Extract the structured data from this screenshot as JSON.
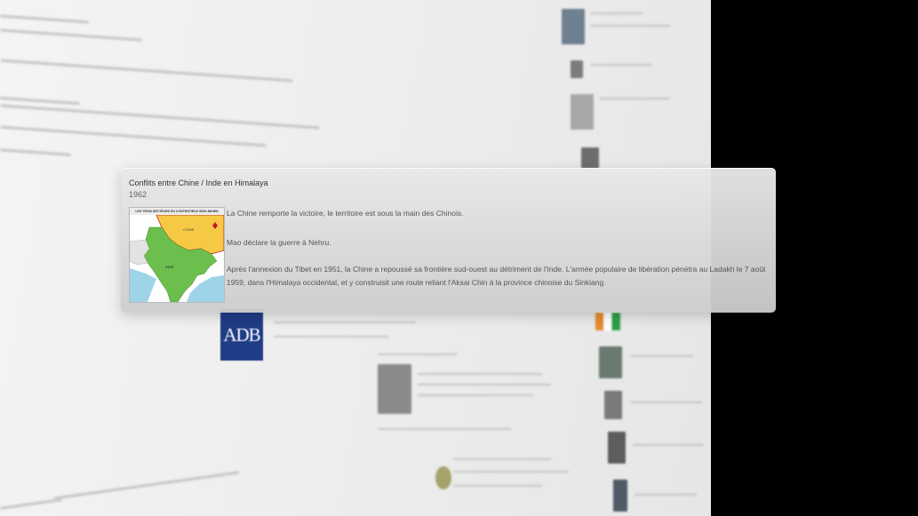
{
  "card": {
    "title": "Conflits entre Chine / Inde en Himalaya",
    "year": "1962",
    "map_caption": "LES TROIS SECTEURS DU CONTENTIEUX SINO-INDIEN",
    "paragraphs": [
      "La Chine remporte la victoire, le territoire est sous la main des Chinois.",
      "Mao déclare la guerre à Nehru.",
      "Après l'annexion du Tibet en 1951, la Chine a repoussé sa frontière sud-ouest au détriment de l'Inde. L'armée populaire de libération pénétra au Ladakh le 7 août 1959, dans l'Himalaya occidental, et y construisit une route reliant l'Aksai Chin à la province chinoise du Sinkiang."
    ]
  },
  "background_page": {
    "logo_text": "ADB"
  },
  "colors": {
    "backdrop": "#000000",
    "map_india": "#6cbf4c",
    "map_china": "#f6c945",
    "map_sea": "#9fd3e8",
    "logo_blue": "#1f3c86"
  }
}
